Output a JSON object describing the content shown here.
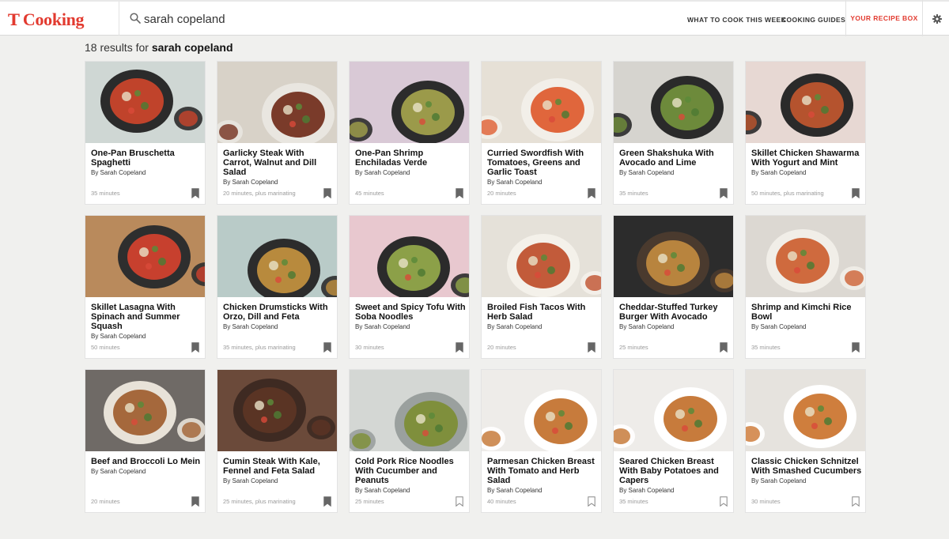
{
  "header": {
    "logo_mark": "T",
    "logo_word": "Cooking",
    "search_value": "sarah copeland",
    "nav": [
      "WHAT TO COOK THIS WEEK",
      "COOKING GUIDES"
    ],
    "recipe_box": "YOUR RECIPE BOX",
    "brand_color": "#e23a2f"
  },
  "results": {
    "prefix": "18 results for",
    "query": "sarah copeland"
  },
  "recipes": [
    {
      "title": "One-Pan Bruschetta Spaghetti",
      "byline": "By Sarah Copeland",
      "time": "35 minutes",
      "saved": true,
      "bg": "#cfd7d4",
      "food": "#c0432b",
      "dish": "#2b2b2b"
    },
    {
      "title": "Garlicky Steak With Carrot, Walnut and Dill Salad",
      "byline": "By Sarah Copeland",
      "time": "20 minutes, plus marinating",
      "saved": true,
      "bg": "#d8d2c8",
      "food": "#7a3b2a",
      "dish": "#e9e6e0"
    },
    {
      "title": "One-Pan Shrimp Enchiladas Verde",
      "byline": "By Sarah Copeland",
      "time": "45 minutes",
      "saved": true,
      "bg": "#d9c9d6",
      "food": "#9b9a4a",
      "dish": "#2c2c2c"
    },
    {
      "title": "Curried Swordfish With Tomatoes, Greens and Garlic Toast",
      "byline": "By Sarah Copeland",
      "time": "20 minutes",
      "saved": true,
      "bg": "#e6e0d6",
      "food": "#e0663c",
      "dish": "#f2efe9"
    },
    {
      "title": "Green Shakshuka With Avocado and Lime",
      "byline": "By Sarah Copeland",
      "time": "35 minutes",
      "saved": true,
      "bg": "#d6d4cf",
      "food": "#6d8a3b",
      "dish": "#2a2a2a"
    },
    {
      "title": "Skillet Chicken Shawarma With Yogurt and Mint",
      "byline": "By Sarah Copeland",
      "time": "50 minutes, plus marinating",
      "saved": true,
      "bg": "#e7d8d3",
      "food": "#b5532e",
      "dish": "#2a2a2a"
    },
    {
      "title": "Skillet Lasagna With Spinach and Summer Squash",
      "byline": "By Sarah Copeland",
      "time": "50 minutes",
      "saved": true,
      "bg": "#b98a5c",
      "food": "#c7402e",
      "dish": "#2e2e2e"
    },
    {
      "title": "Chicken Drumsticks With Orzo, Dill and Feta",
      "byline": "By Sarah Copeland",
      "time": "35 minutes, plus marinating",
      "saved": true,
      "bg": "#b9cbc8",
      "food": "#b88a3d",
      "dish": "#2c2c2c"
    },
    {
      "title": "Sweet and Spicy Tofu With Soba Noodles",
      "byline": "By Sarah Copeland",
      "time": "30 minutes",
      "saved": true,
      "bg": "#e8c8cf",
      "food": "#8ca048",
      "dish": "#2b2b2b"
    },
    {
      "title": "Broiled Fish Tacos With Herb Salad",
      "byline": "By Sarah Copeland",
      "time": "20 minutes",
      "saved": true,
      "bg": "#e5e1d9",
      "food": "#c25b3a",
      "dish": "#f4f1ea"
    },
    {
      "title": "Cheddar-Stuffed Turkey Burger With Avocado",
      "byline": "By Sarah Copeland",
      "time": "25 minutes",
      "saved": true,
      "bg": "#2c2c2c",
      "food": "#b8843e",
      "dish": "#4a3a2e"
    },
    {
      "title": "Shrimp and Kimchi Rice Bowl",
      "byline": "By Sarah Copeland",
      "time": "35 minutes",
      "saved": true,
      "bg": "#dcd8d2",
      "food": "#cf6a3e",
      "dish": "#f1eee8"
    },
    {
      "title": "Beef and Broccoli Lo Mein",
      "byline": "By Sarah Copeland",
      "time": "20 minutes",
      "saved": true,
      "bg": "#6f6a66",
      "food": "#a5683c",
      "dish": "#e8e2d8"
    },
    {
      "title": "Cumin Steak With Kale, Fennel and Feta Salad",
      "byline": "By Sarah Copeland",
      "time": "25 minutes, plus marinating",
      "saved": true,
      "bg": "#6b4a3a",
      "food": "#5a3424",
      "dish": "#3e2a22"
    },
    {
      "title": "Cold Pork Rice Noodles With Cucumber and Peanuts",
      "byline": "By Sarah Copeland",
      "time": "25 minutes",
      "saved": false,
      "bg": "#d4d7d4",
      "food": "#7f8f3c",
      "dish": "#9aa09e"
    },
    {
      "title": "Parmesan Chicken Breast With Tomato and Herb Salad",
      "byline": "By Sarah Copeland",
      "time": "40 minutes",
      "saved": false,
      "bg": "#eeece9",
      "food": "#c77b3c",
      "dish": "#ffffff"
    },
    {
      "title": "Seared Chicken Breast With Baby Potatoes and Capers",
      "byline": "By Sarah Copeland",
      "time": "35 minutes",
      "saved": false,
      "bg": "#eeece9",
      "food": "#c77b3c",
      "dish": "#ffffff"
    },
    {
      "title": "Classic Chicken Schnitzel With Smashed Cucumbers",
      "byline": "By Sarah Copeland",
      "time": "30 minutes",
      "saved": false,
      "bg": "#e6e3de",
      "food": "#cf7e3d",
      "dish": "#ffffff"
    }
  ]
}
